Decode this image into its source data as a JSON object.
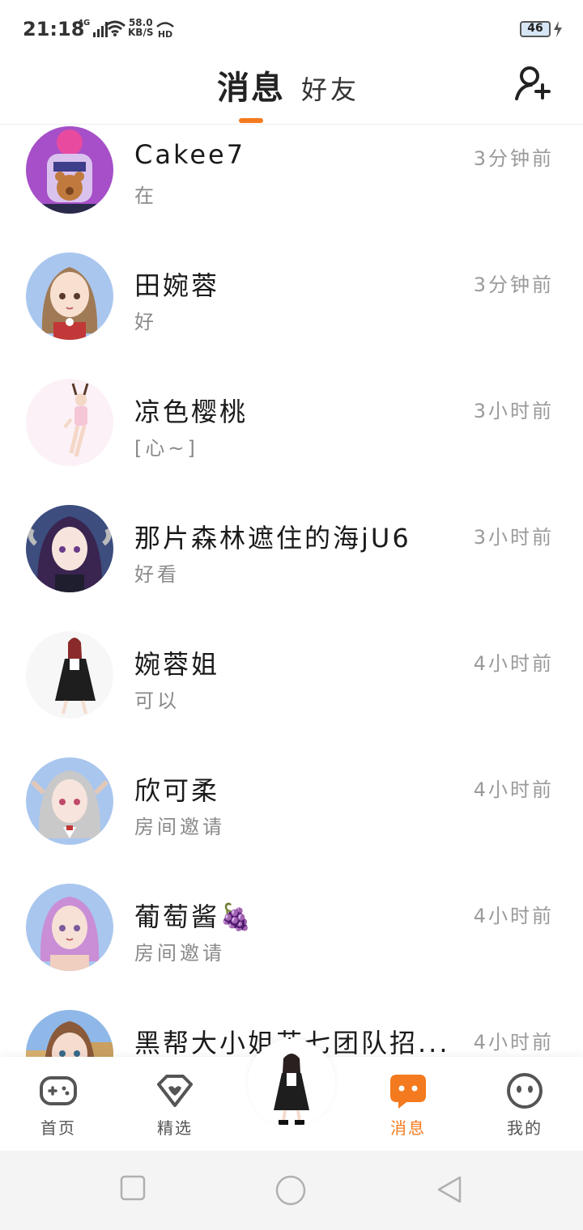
{
  "status_bar": {
    "time": "21:18",
    "network": "4G",
    "speed_value": "58.0",
    "speed_unit": "KB/S",
    "hd": "HD",
    "battery": "46"
  },
  "header": {
    "tab_messages": "消息",
    "tab_friends": "好友",
    "add_friend_icon": "add-user-icon",
    "accent_color": "#f47a1f"
  },
  "conversations": [
    {
      "name": "Cakee7",
      "preview": "在",
      "time": "3分钟前"
    },
    {
      "name": "田婉蓉",
      "preview": "好",
      "time": "3分钟前"
    },
    {
      "name": "凉色樱桃",
      "preview": "[心~]",
      "time": "3小时前"
    },
    {
      "name": "那片森林遮住的海jU6",
      "preview": "好看",
      "time": "3小时前"
    },
    {
      "name": "婉蓉姐",
      "preview": "可以",
      "time": "4小时前"
    },
    {
      "name": "欣可柔",
      "preview": "房间邀请",
      "time": "4小时前"
    },
    {
      "name": "葡萄酱🍇",
      "preview": "房间邀请",
      "time": "4小时前"
    },
    {
      "name": "黑帮大小姐芷七团队招...",
      "preview": "",
      "time": "4小时前"
    }
  ],
  "bottom_nav": {
    "home": "首页",
    "featured": "精选",
    "messages": "消息",
    "mine": "我的"
  }
}
